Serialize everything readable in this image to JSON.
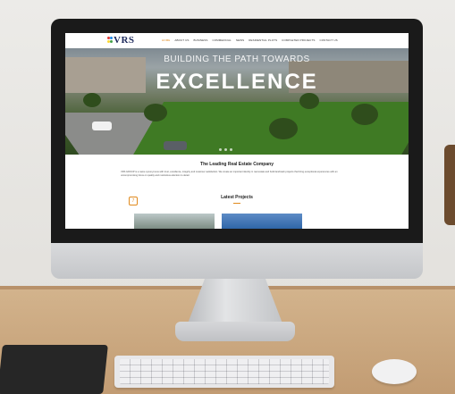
{
  "site": {
    "logo": "VRS",
    "nav": [
      "HOME",
      "ABOUT US",
      "BUSINESS",
      "COMMERCIAL",
      "NEWS",
      "RESIDENTIAL PLOTS",
      "COMPLETED PROJECTS",
      "CONTACT US"
    ],
    "hero": {
      "subtitle": "BUILDING THE PATH TOWARDS",
      "title": "EXCELLENCE"
    },
    "tagline": "The Leading Real Estate Company",
    "about": "VRS GROUP is a name synonymous with trust, excellence, integrity and customer satisfaction. We create an important identity in real estate and build landmark projects that bring exceptional experiences with an uncompromising focus on quality and meticulous attention to detail.",
    "latest_projects": {
      "heading": "Latest Projects",
      "badge": "7"
    }
  },
  "colors": {
    "accent": "#e08a1e",
    "logo": "#1d2a5c"
  }
}
